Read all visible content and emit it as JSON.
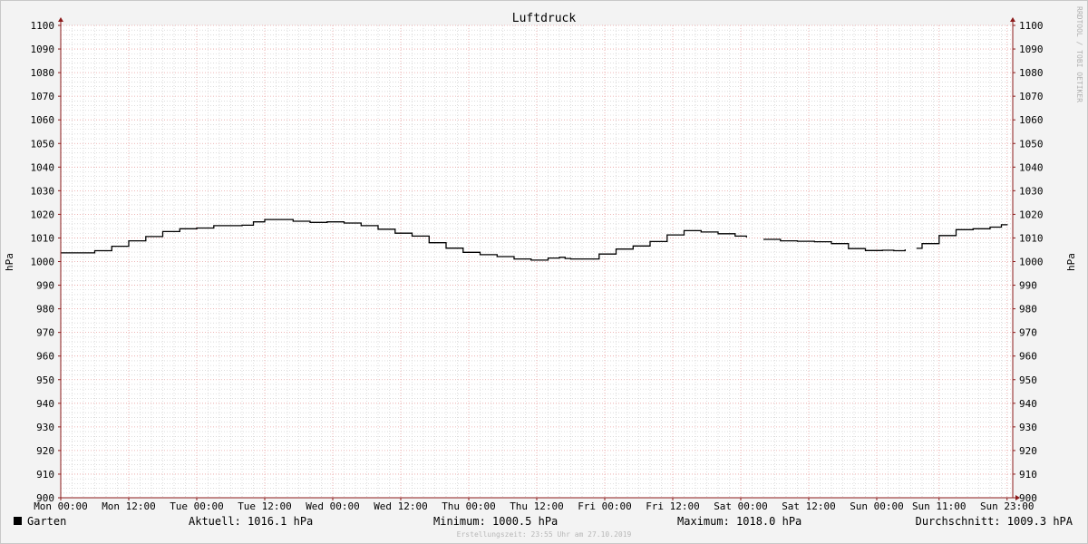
{
  "chart_data": {
    "type": "line",
    "title": "Luftdruck",
    "ylabel": "hPa",
    "ylim": [
      900,
      1100
    ],
    "y_ticks": [
      900,
      910,
      920,
      930,
      940,
      950,
      960,
      970,
      980,
      990,
      1000,
      1010,
      1020,
      1030,
      1040,
      1050,
      1060,
      1070,
      1080,
      1090,
      1100
    ],
    "x_ticks": [
      {
        "label": "Mon 00:00",
        "t": 0
      },
      {
        "label": "Mon 12:00",
        "t": 12
      },
      {
        "label": "Tue 00:00",
        "t": 24
      },
      {
        "label": "Tue 12:00",
        "t": 36
      },
      {
        "label": "Wed 00:00",
        "t": 48
      },
      {
        "label": "Wed 12:00",
        "t": 60
      },
      {
        "label": "Thu 00:00",
        "t": 72
      },
      {
        "label": "Thu 12:00",
        "t": 84
      },
      {
        "label": "Fri 00:00",
        "t": 96
      },
      {
        "label": "Fri 12:00",
        "t": 108
      },
      {
        "label": "Sat 00:00",
        "t": 120
      },
      {
        "label": "Sat 12:00",
        "t": 132
      },
      {
        "label": "Sun 00:00",
        "t": 144
      },
      {
        "label": "Sun 11:00",
        "t": 155
      },
      {
        "label": "Sun 23:00",
        "t": 167
      }
    ],
    "xlim": [
      0,
      168
    ],
    "grid": true,
    "legend_placement": "bottom-left",
    "series": [
      {
        "name": "Garten",
        "color": "#000000",
        "points": [
          [
            0,
            1003.7
          ],
          [
            3,
            1003.7
          ],
          [
            6,
            1004.6
          ],
          [
            9,
            1006.5
          ],
          [
            12,
            1008.8
          ],
          [
            15,
            1010.6
          ],
          [
            18,
            1012.7
          ],
          [
            21,
            1013.9
          ],
          [
            24,
            1014.2
          ],
          [
            27,
            1015.2
          ],
          [
            30,
            1015.2
          ],
          [
            32,
            1015.4
          ],
          [
            34,
            1016.8
          ],
          [
            36,
            1017.8
          ],
          [
            38,
            1017.8
          ],
          [
            41,
            1017.1
          ],
          [
            44,
            1016.6
          ],
          [
            47,
            1016.8
          ],
          [
            50,
            1016.3
          ],
          [
            53,
            1015.2
          ],
          [
            56,
            1013.7
          ],
          [
            59,
            1012.0
          ],
          [
            62,
            1010.8
          ],
          [
            65,
            1008.0
          ],
          [
            68,
            1005.7
          ],
          [
            71,
            1003.9
          ],
          [
            74,
            1002.9
          ],
          [
            77,
            1002.1
          ],
          [
            80,
            1001.1
          ],
          [
            83,
            1000.6
          ],
          [
            86,
            1001.5
          ],
          [
            88,
            1001.8
          ],
          [
            89,
            1001.3
          ],
          [
            90,
            1001.1
          ],
          [
            92,
            1001.1
          ],
          [
            95,
            1003.2
          ],
          [
            98,
            1005.3
          ],
          [
            101,
            1006.6
          ],
          [
            104,
            1008.5
          ],
          [
            107,
            1011.3
          ],
          [
            110,
            1013.1
          ],
          [
            113,
            1012.5
          ],
          [
            116,
            1011.8
          ],
          [
            119,
            1010.8
          ],
          [
            121,
            1010.2
          ],
          [
            122,
            null
          ],
          [
            124,
            1009.4
          ],
          [
            127,
            1008.8
          ],
          [
            130,
            1008.6
          ],
          [
            133,
            1008.4
          ],
          [
            136,
            1007.6
          ],
          [
            139,
            1005.5
          ],
          [
            142,
            1004.7
          ],
          [
            145,
            1004.8
          ],
          [
            147,
            1004.6
          ],
          [
            149,
            1005.2
          ],
          [
            150,
            null
          ],
          [
            151,
            1005.6
          ],
          [
            152,
            1007.6
          ],
          [
            155,
            1011.0
          ],
          [
            158,
            1013.5
          ],
          [
            161,
            1013.9
          ],
          [
            164,
            1014.6
          ],
          [
            166,
            1015.6
          ],
          [
            167,
            1015.8
          ]
        ]
      }
    ],
    "stats": {
      "current_label": "Aktuell:",
      "current": "1016.1 hPa",
      "minimum_label": "Minimum:",
      "minimum": "1000.5 hPa",
      "maximum_label": "Maximum:",
      "maximum": "1018.0 hPa",
      "average_label": "Durchschnitt:",
      "average": "1009.3 hPA"
    },
    "watermark": "RRDTOOL / TOBI OETIKER",
    "footer": "Erstellungszeit: 23:55 Uhr am 27.10.2019"
  },
  "colors": {
    "background": "#f3f3f3",
    "canvas": "#ffffff",
    "grid_minor": "#c8c8c8",
    "grid_major": "#e8a0a0",
    "axis": "#8b1a1a",
    "text": "#000000",
    "watermark": "#b0b0b0",
    "footer": "#b8b8b8"
  }
}
